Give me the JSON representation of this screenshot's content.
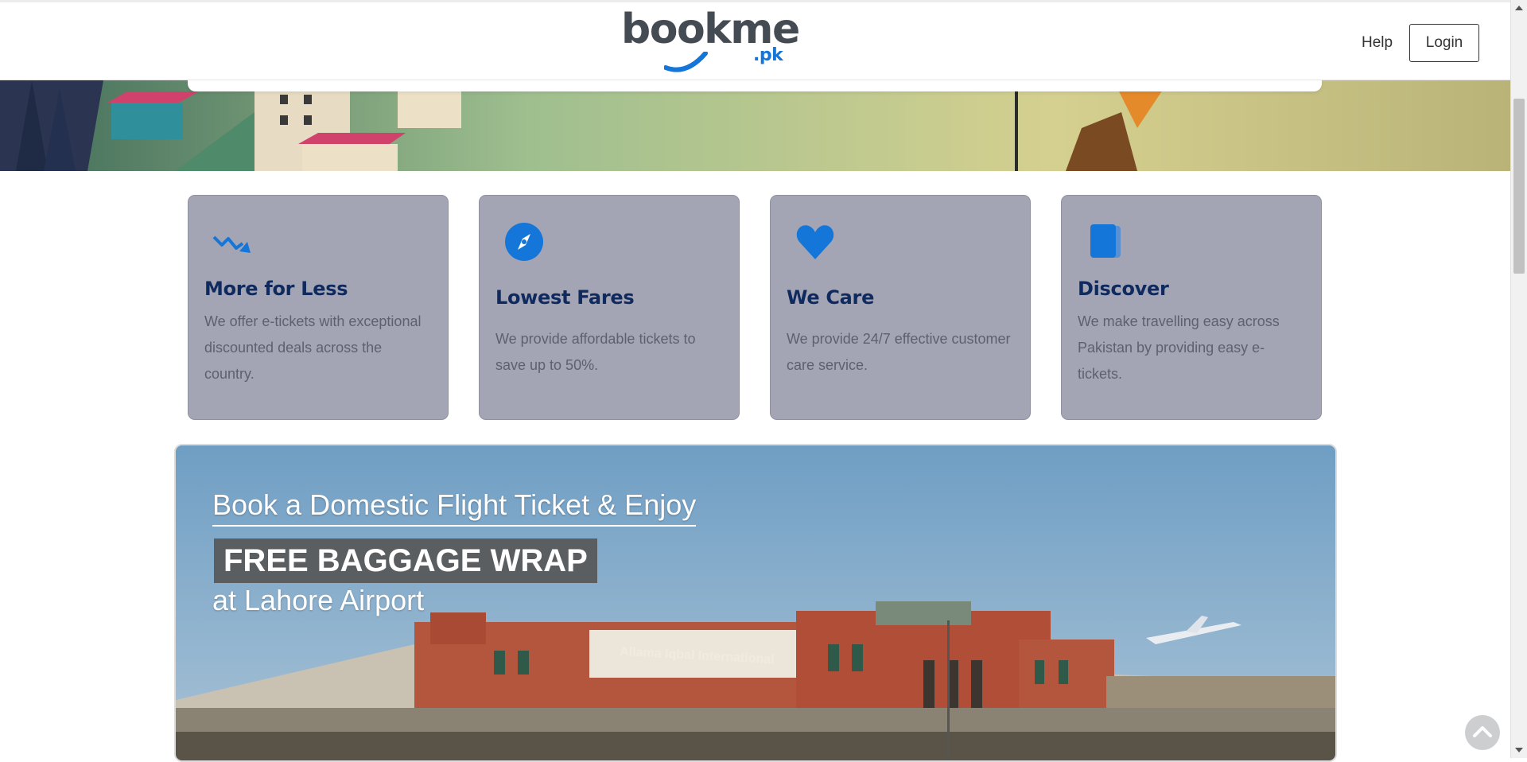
{
  "header": {
    "logo_word": "bookme",
    "logo_tld": ".pk",
    "help_label": "Help",
    "login_label": "Login"
  },
  "features": [
    {
      "title": "More for Less",
      "text": "We offer e-tickets with exceptional discounted deals across the country.",
      "icon": "trending-down-icon"
    },
    {
      "title": "Lowest Fares",
      "text": "We provide affordable tickets to save up to 50%.",
      "icon": "compass-icon"
    },
    {
      "title": "We Care",
      "text": "We provide 24/7 effective customer care service.",
      "icon": "heart-icon"
    },
    {
      "title": "Discover",
      "text": "We make travelling easy across Pakistan by providing easy e-tickets.",
      "icon": "ticket-book-icon"
    }
  ],
  "promo": {
    "line1": "Book a Domestic Flight Ticket & Enjoy",
    "line2": "FREE BAGGAGE WRAP",
    "line3": "at Lahore Airport",
    "terminal_sign": "Allama Iqbal International"
  },
  "colors": {
    "accent": "#1476d8",
    "card_bg": "#a4a5b4",
    "card_title": "#0f2a5e"
  }
}
